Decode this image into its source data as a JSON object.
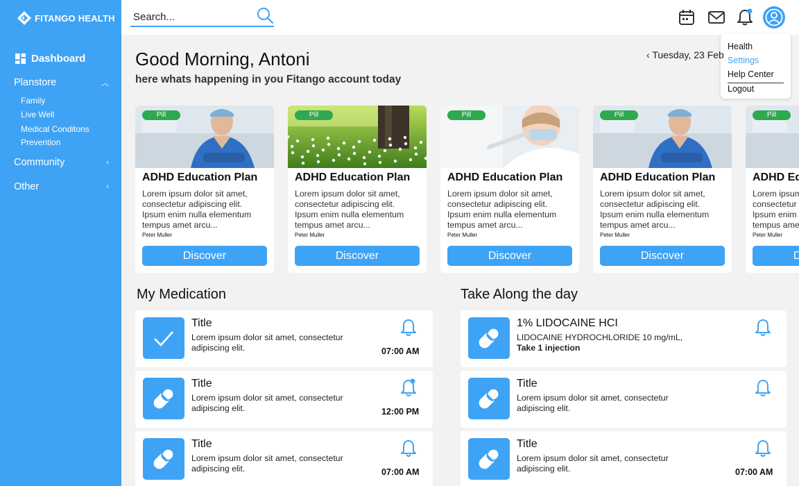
{
  "brand": {
    "name": "FITANGO HEALTH"
  },
  "colors": {
    "primary": "#3ea3f5",
    "pill": "#2fa84f",
    "background": "#f2f2f2"
  },
  "sidebar": {
    "dashboard": "Dashboard",
    "groups": [
      {
        "label": "Planstore",
        "expanded": true,
        "items": [
          "Family",
          "Live Well",
          "Medical Conditons",
          "Prevention"
        ]
      },
      {
        "label": "Community",
        "expanded": false
      },
      {
        "label": "Other",
        "expanded": false
      }
    ]
  },
  "header": {
    "search_placeholder": "Search..."
  },
  "user_menu": {
    "items": [
      "Health",
      "Settings",
      "Help Center",
      "Logout"
    ],
    "active": "Settings"
  },
  "greeting": {
    "title": "Good Morning, Antoni",
    "subtitle": "here whats happening in you Fitango account today",
    "date": "Tuesday, 23 Feb"
  },
  "cards": [
    {
      "tag": "Pill",
      "title": "ADHD Education Plan",
      "description": "Lorem ipsum dolor sit amet, consectetur adipiscing elit. Ipsum enim nulla elementum tempus amet arcu...",
      "author": "Peter Muller",
      "button": "Discover",
      "image": "doctor"
    },
    {
      "tag": "Pill",
      "title": "ADHD Education Plan",
      "description": "Lorem ipsum dolor sit amet, consectetur adipiscing elit. Ipsum enim nulla elementum tempus amet arcu...",
      "author": "Peter Muller",
      "button": "Discover",
      "image": "meadow"
    },
    {
      "tag": "Pill",
      "title": "ADHD Education Plan",
      "description": "Lorem ipsum dolor sit amet, consectetur adipiscing elit. Ipsum enim nulla elementum tempus amet arcu...",
      "author": "Peter Muller",
      "button": "Discover",
      "image": "lab"
    },
    {
      "tag": "Pill",
      "title": "ADHD Education Plan",
      "description": "Lorem ipsum dolor sit amet, consectetur adipiscing elit. Ipsum enim nulla elementum tempus amet arcu...",
      "author": "Peter Muller",
      "button": "Discover",
      "image": "doctor"
    },
    {
      "tag": "Pill",
      "title": "ADHD Education Plan",
      "description": "Lorem ipsum dolor sit amet, consectetur adipiscing elit. Ipsum enim nulla elementum tempus amet arcu...",
      "author": "Peter Muller",
      "button": "Discover",
      "image": "doctor"
    }
  ],
  "medication": {
    "title": "My Medication",
    "items": [
      {
        "icon": "check-icon",
        "title": "Title",
        "description": "Lorem ipsum dolor sit amet, consectetur adipiscing elit.",
        "time": "07:00 AM",
        "notified": false
      },
      {
        "icon": "pill-icon",
        "title": "Title",
        "description": "Lorem ipsum dolor sit amet, consectetur adipiscing elit.",
        "time": "12:00 PM",
        "notified": true
      },
      {
        "icon": "pill-icon",
        "title": "Title",
        "description": "Lorem ipsum dolor sit amet, consectetur adipiscing elit.",
        "time": "07:00 AM",
        "notified": false
      }
    ]
  },
  "take_along": {
    "title": "Take Along the day",
    "items": [
      {
        "icon": "pill-icon",
        "title": "1% LIDOCAINE HCI",
        "description": "LIDOCAINE HYDROCHLORIDE 10 mg/mL,",
        "instruction": "Take 1 injection",
        "time": ""
      },
      {
        "icon": "pill-icon",
        "title": "Title",
        "description": "Lorem ipsum dolor sit amet, consectetur adipiscing elit.",
        "time": ""
      },
      {
        "icon": "pill-icon",
        "title": "Title",
        "description": "Lorem ipsum dolor sit amet, consectetur adipiscing elit.",
        "time": "07:00 AM"
      }
    ]
  }
}
